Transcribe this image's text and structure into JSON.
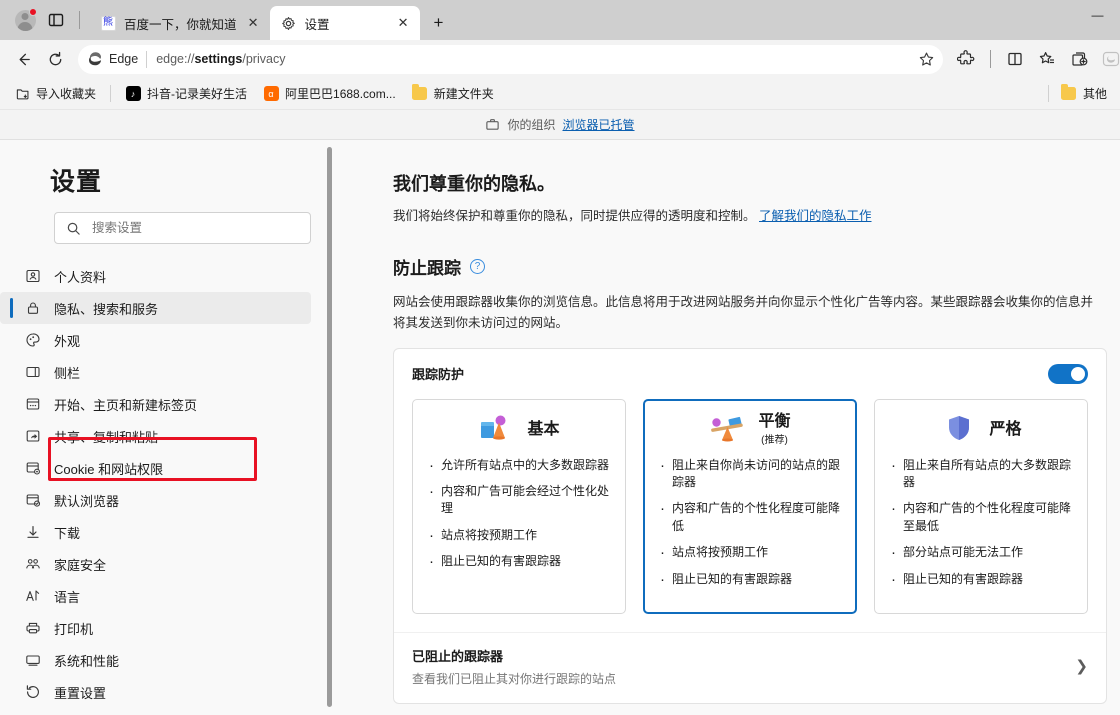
{
  "window": {
    "minimize_label": "—"
  },
  "tabbar": {
    "profile_name": "profile-avatar",
    "tab_list_title": "选项卡操作菜单",
    "tabs": [
      {
        "title": "百度一下，你就知道",
        "favicon": "baidu-favicon",
        "active": false,
        "close_label": "✕"
      },
      {
        "title": "设置",
        "favicon": "gear-icon",
        "active": true,
        "close_label": "✕"
      }
    ],
    "new_tab_label": "+"
  },
  "toolbar": {
    "back_label": "←",
    "refresh_label": "⟳",
    "omnibox": {
      "edge_label": "Edge",
      "url_prefix": "edge://",
      "url_bold": "settings",
      "url_suffix": "/privacy",
      "favorite_icon": "star-icon"
    },
    "right_icons": [
      "extensions-icon",
      "split-screen-icon",
      "favorites-icon",
      "collections-icon",
      "copilot-icon"
    ]
  },
  "bookmarks": {
    "import_label": "导入收藏夹",
    "items": [
      {
        "label": "抖音-记录美好生活",
        "icon": "douyin-favicon"
      },
      {
        "label": "阿里巴巴1688.com...",
        "icon": "alibaba-favicon"
      },
      {
        "label": "新建文件夹",
        "icon": "folder-icon"
      }
    ],
    "other_label": "其他"
  },
  "managed_banner": {
    "prefix": "你的组织",
    "link": "浏览器已托管",
    "icon": "briefcase-icon"
  },
  "sidebar": {
    "title": "设置",
    "search": {
      "placeholder": "搜索设置",
      "value": "",
      "icon": "search-icon"
    },
    "items": [
      {
        "label": "个人资料",
        "icon": "profile-icon",
        "selected": false
      },
      {
        "label": "隐私、搜索和服务",
        "icon": "lock-icon",
        "selected": true
      },
      {
        "label": "外观",
        "icon": "palette-icon",
        "selected": false
      },
      {
        "label": "侧栏",
        "icon": "sidebar-icon",
        "selected": false
      },
      {
        "label": "开始、主页和新建标签页",
        "icon": "home-icon",
        "selected": false
      },
      {
        "label": "共享、复制和粘贴",
        "icon": "share-icon",
        "selected": false
      },
      {
        "label": "Cookie 和网站权限",
        "icon": "cookie-icon",
        "selected": false
      },
      {
        "label": "默认浏览器",
        "icon": "default-browser-icon",
        "selected": false
      },
      {
        "label": "下载",
        "icon": "download-icon",
        "selected": false
      },
      {
        "label": "家庭安全",
        "icon": "family-icon",
        "selected": false
      },
      {
        "label": "语言",
        "icon": "language-icon",
        "selected": false
      },
      {
        "label": "打印机",
        "icon": "printer-icon",
        "selected": false
      },
      {
        "label": "系统和性能",
        "icon": "system-icon",
        "selected": false
      },
      {
        "label": "重置设置",
        "icon": "reset-icon",
        "selected": false
      }
    ]
  },
  "main": {
    "privacy_heading": "我们尊重你的隐私。",
    "privacy_desc": "我们将始终保护和尊重你的隐私，同时提供应得的透明度和控制。",
    "privacy_link": "了解我们的隐私工作",
    "tracking_heading": "防止跟踪",
    "tracking_help_icon": "help-icon",
    "tracking_desc": "网站会使用跟踪器收集你的浏览信息。此信息将用于改进网站服务并向你显示个性化广告等内容。某些跟踪器会收集你的信息并将其发送到你未访问过的网站。",
    "tracking_card": {
      "label": "跟踪防护",
      "toggle_on": true,
      "toggle_color": "#1173c7"
    },
    "options": [
      {
        "title": "基本",
        "subtitle": "",
        "icon": "shapes-icon",
        "selected": false,
        "bullets": [
          "允许所有站点中的大多数跟踪器",
          "内容和广告可能会经过个性化处理",
          "站点将按预期工作",
          "阻止已知的有害跟踪器"
        ]
      },
      {
        "title": "平衡",
        "subtitle": "(推荐)",
        "icon": "balance-icon",
        "selected": true,
        "bullets": [
          "阻止来自你尚未访问的站点的跟踪器",
          "内容和广告的个性化程度可能降低",
          "站点将按预期工作",
          "阻止已知的有害跟踪器"
        ]
      },
      {
        "title": "严格",
        "subtitle": "",
        "icon": "shield-icon",
        "selected": false,
        "bullets": [
          "阻止来自所有站点的大多数跟踪器",
          "内容和广告的个性化程度可能降至最低",
          "部分站点可能无法工作",
          "阻止已知的有害跟踪器"
        ]
      }
    ],
    "blocked_row": {
      "title": "已阻止的跟踪器",
      "subtitle": "查看我们已阻止其对你进行跟踪的站点",
      "chevron": "❯"
    }
  },
  "colors": {
    "accent": "#0f6cbd",
    "toggle": "#1173c7",
    "link": "#0b5fb0",
    "annotation": "#e81123"
  }
}
